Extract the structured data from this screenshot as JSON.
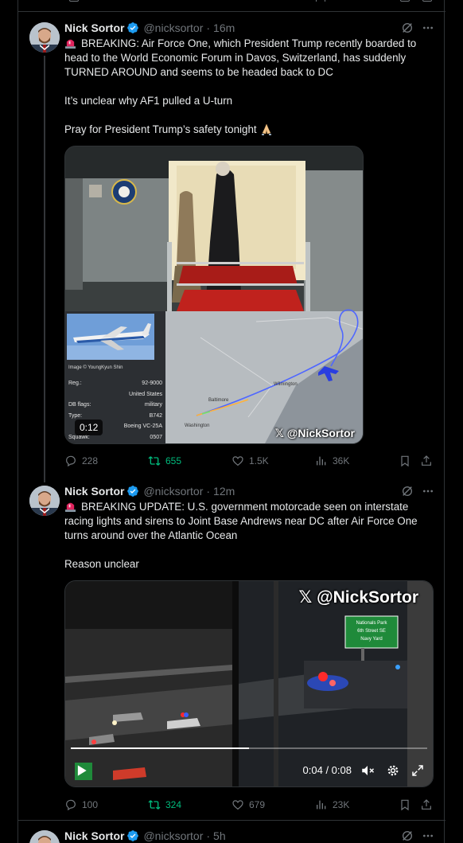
{
  "tweets": [
    {
      "author": "Nick Sortor",
      "handle": "@nicksortor",
      "time": "16m",
      "text": [
        "BREAKING: Air Force One, which President Trump recently boarded to head to the World Economic Forum in Davos, Switzerland, has suddenly TURNED AROUND and seems to be headed back to DC",
        "It’s unclear why AF1 pulled a U-turn",
        "Pray for President Trump’s safety tonight"
      ],
      "media": {
        "duration": "0:12",
        "watermark": "𝕏 @NickSortor",
        "photo_credit": "Image © YoungKyun Shin",
        "info_rows": [
          {
            "label": "Reg.:",
            "value": "92-9000"
          },
          {
            "label": "",
            "value": "United States"
          },
          {
            "label": "DB flags:",
            "value": "military"
          },
          {
            "label": "Type:",
            "value": "B742"
          },
          {
            "label": "",
            "value": "Boeing VC-25A"
          },
          {
            "label": "Squawk:",
            "value": "0507"
          }
        ],
        "map_labels": [
          "Wilmington",
          "Washington",
          "Baltimore"
        ]
      },
      "replies": "228",
      "reposts": "655",
      "likes": "1.5K",
      "views": "36K"
    },
    {
      "author": "Nick Sortor",
      "handle": "@nicksortor",
      "time": "12m",
      "text": [
        "BREAKING UPDATE: U.S. government motorcade seen on interstate racing lights and sirens to Joint Base Andrews near DC after Air Force One turns around over the Atlantic Ocean",
        "Reason unclear"
      ],
      "media": {
        "watermark": "𝕏 @NickSortor",
        "sign_lines": [
          "Nationals Park",
          "6th Street SE",
          "Navy Yard"
        ],
        "current_time": "0:04 / 0:08",
        "progress": 0.5
      },
      "replies": "100",
      "reposts": "324",
      "likes": "679",
      "views": "23K"
    },
    {
      "author": "Nick Sortor",
      "handle": "@nicksortor",
      "time": "5h"
    }
  ],
  "colors": {
    "background": "#000000",
    "border": "#2f3336",
    "muted": "#71767b",
    "text": "#e7e9ea",
    "repost_active": "#00ba7c",
    "verified": "#1d9bf0"
  }
}
